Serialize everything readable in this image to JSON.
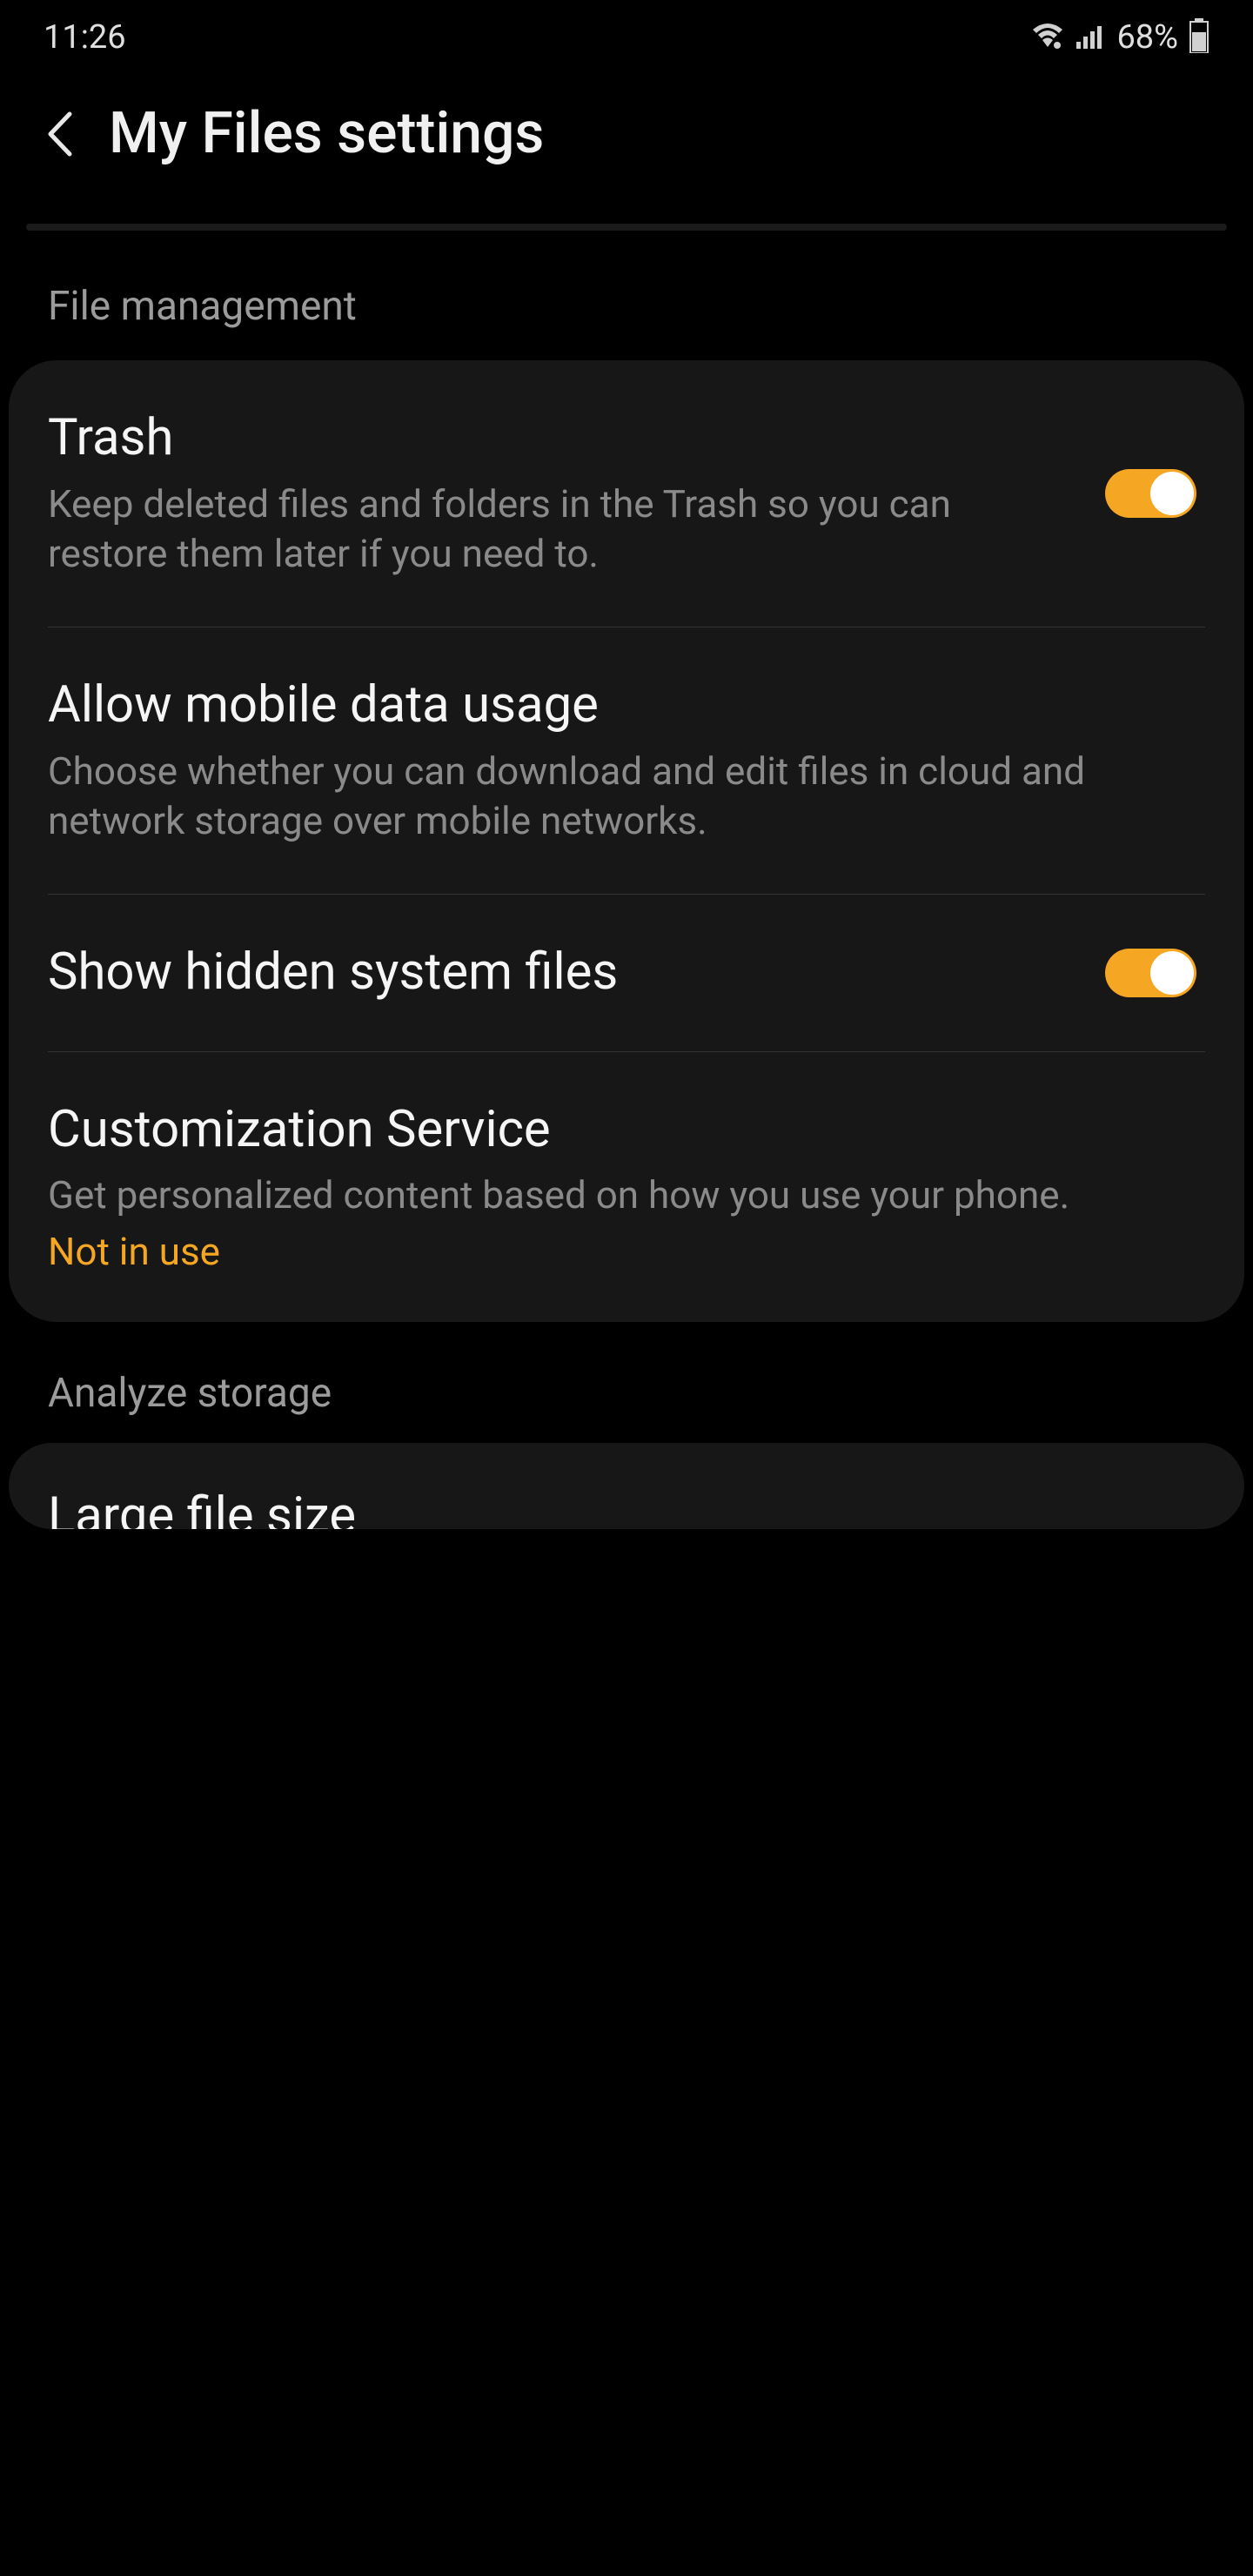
{
  "status": {
    "time": "11:26",
    "battery": "68%"
  },
  "header": {
    "title": "My Files settings"
  },
  "sections": {
    "file_management": {
      "label": "File management",
      "items": {
        "trash": {
          "title": "Trash",
          "desc": "Keep deleted files and folders in the Trash so you can restore them later if you need to."
        },
        "mobile_data": {
          "title": "Allow mobile data usage",
          "desc": "Choose whether you can download and edit files in cloud and network storage over mobile networks."
        },
        "hidden_files": {
          "title": "Show hidden system files"
        },
        "customization": {
          "title": "Customization Service",
          "desc": "Get personalized content based on how you use your phone.",
          "status": "Not in use"
        }
      }
    },
    "analyze_storage": {
      "label": "Analyze storage",
      "items": {
        "large_file": {
          "title": "Large file size"
        }
      }
    }
  }
}
